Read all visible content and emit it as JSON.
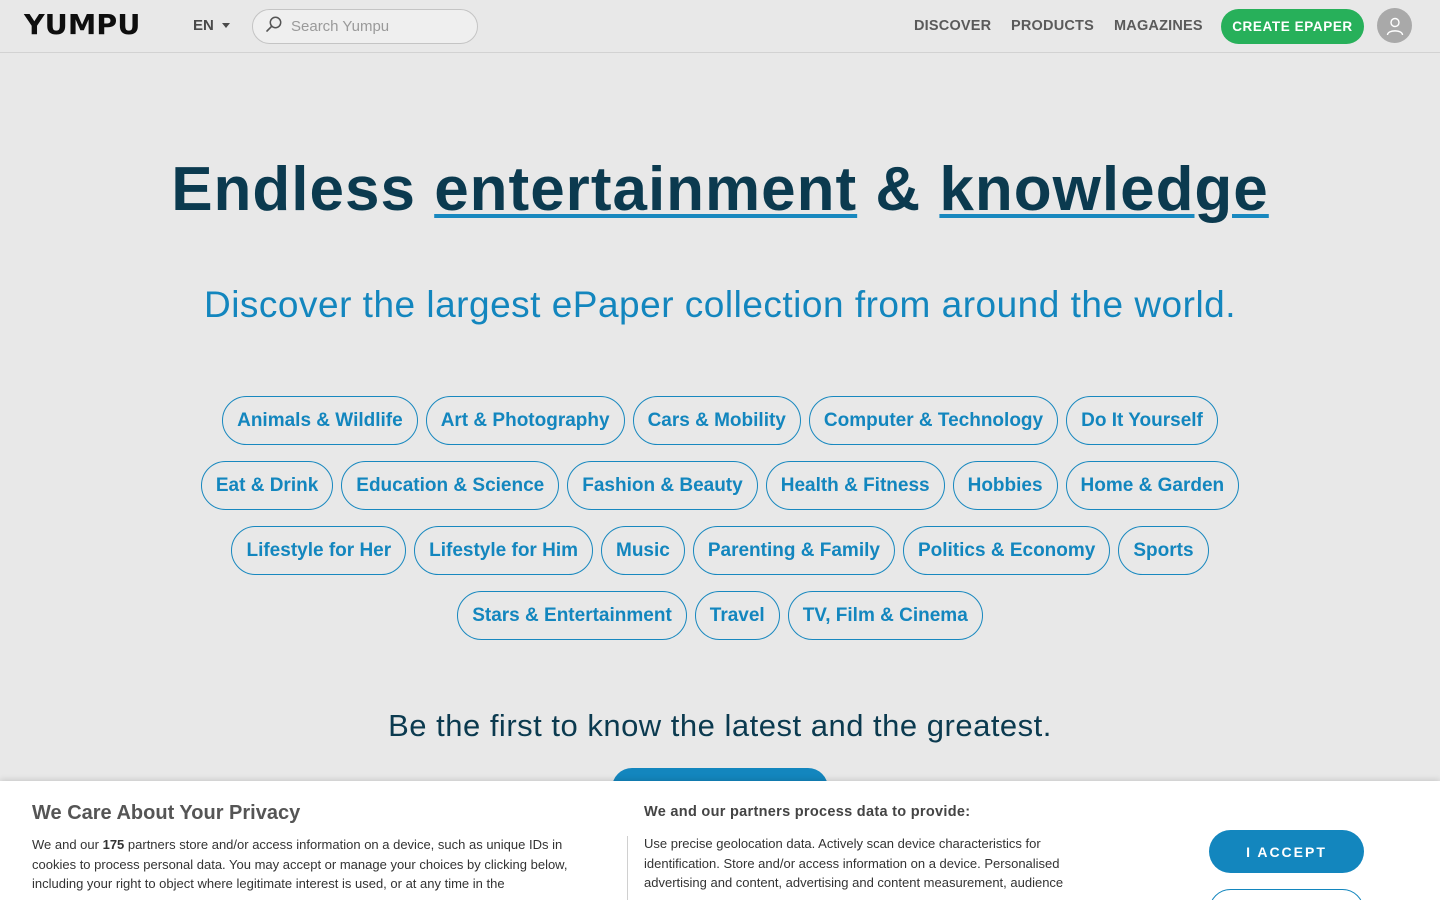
{
  "header": {
    "logo": "YUMPU",
    "language": "EN",
    "search_placeholder": "Search Yumpu",
    "nav": [
      "DISCOVER",
      "PRODUCTS",
      "MAGAZINES"
    ],
    "create_button": "CREATE EPAPER"
  },
  "hero": {
    "title_part1": "Endless ",
    "title_link1": "entertainment",
    "title_part2": " & ",
    "title_link2": "knowledge",
    "subtitle": "Discover the largest ePaper collection from around the world."
  },
  "categories": [
    "Animals & Wildlife",
    "Art & Photography",
    "Cars & Mobility",
    "Computer & Technology",
    "Do It Yourself",
    "Eat & Drink",
    "Education & Science",
    "Fashion & Beauty",
    "Health & Fitness",
    "Hobbies",
    "Home & Garden",
    "Lifestyle for Her",
    "Lifestyle for Him",
    "Music",
    "Parenting & Family",
    "Politics & Economy",
    "Sports",
    "Stars & Entertainment",
    "Travel",
    "TV, Film & Cinema"
  ],
  "latest": {
    "text": "Be the first to know the latest and the greatest."
  },
  "privacy": {
    "title": "We Care About Your Privacy",
    "text_before": "We and our ",
    "partners_count": "175",
    "text_after": " partners store and/or access information on a device, such as unique IDs in cookies to process personal data. You may accept or manage your choices by clicking below, including your right to object where legitimate interest is used, or at any time in the",
    "heading2": "We and our partners process data to provide:",
    "text2": "Use precise geolocation data. Actively scan device characteristics for identification. Store and/or access information on a device. Personalised advertising and content, advertising and content measurement, audience",
    "accept_button": "I ACCEPT"
  },
  "colors": {
    "accent_blue": "#1386be",
    "create_green": "#27b05a",
    "title_dark": "#0b3a4f"
  }
}
